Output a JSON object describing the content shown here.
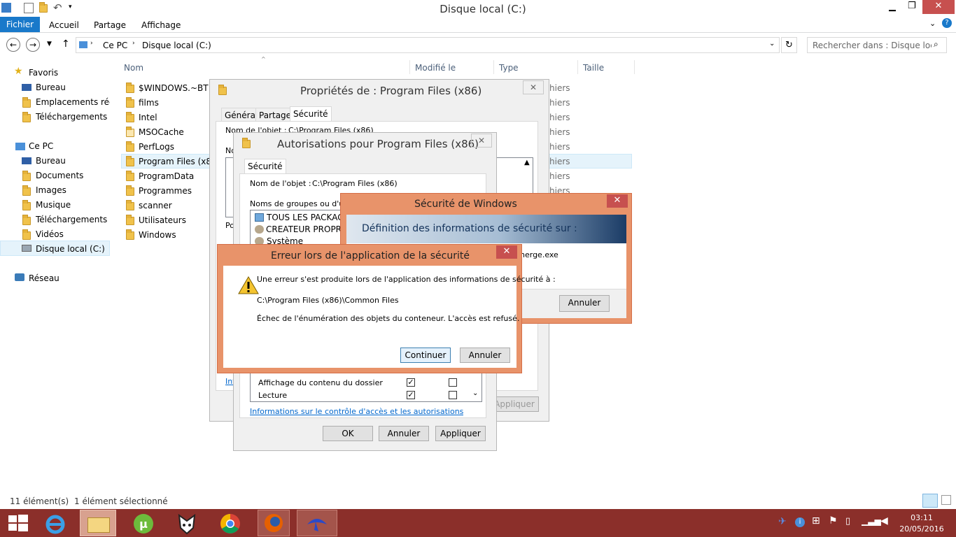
{
  "window": {
    "title": "Disque local (C:)"
  },
  "ribbon": {
    "tabs": [
      "Fichier",
      "Accueil",
      "Partage",
      "Affichage"
    ]
  },
  "address": {
    "segments": [
      "Ce PC",
      "Disque local (C:)"
    ],
    "search_placeholder": "Rechercher dans : Disque loca..."
  },
  "columns": {
    "name": "Nom",
    "modified": "Modifié le",
    "type": "Type",
    "size": "Taille"
  },
  "nav": {
    "favorites": "Favoris",
    "fav_items": [
      "Bureau",
      "Emplacements récen",
      "Téléchargements"
    ],
    "pc": "Ce PC",
    "pc_items": [
      "Bureau",
      "Documents",
      "Images",
      "Musique",
      "Téléchargements",
      "Vidéos",
      "Disque local (C:)"
    ],
    "network": "Réseau"
  },
  "files": [
    "$WINDOWS.~BT",
    "films",
    "Intel",
    "MSOCache",
    "PerfLogs",
    "Program Files (x86)",
    "ProgramData",
    "Programmes",
    "scanner",
    "Utilisateurs",
    "Windows"
  ],
  "type_fragments": [
    "hiers",
    "hiers",
    "hiers",
    "hiers",
    "hiers",
    "hiers",
    "hiers",
    "hiers"
  ],
  "status": {
    "count": "11 élément(s)",
    "selected": "1 élément sélectionné"
  },
  "props": {
    "title": "Propriétés de : Program Files (x86)",
    "tabs": [
      "Général",
      "Partage",
      "Sécurité"
    ],
    "object_label": "Nom de l'objet :",
    "object_value": "C:\\Program Files (x86)",
    "frag_no": "No",
    "frag_po": "Po",
    "frag_inf": "Inf",
    "apply": "Appliquer"
  },
  "perms": {
    "title": "Autorisations pour Program Files (x86)",
    "tab": "Sécurité",
    "object_label": "Nom de l'objet :",
    "object_value": "C:\\Program Files (x86)",
    "groups_label": "Noms de groupes ou d'utilisa",
    "groups": [
      "TOUS LES PACKAGE",
      "CREATEUR PROPRIE",
      "Système"
    ],
    "rows": [
      "Affichage du contenu du dossier",
      "Lecture"
    ],
    "link": "Informations sur le contrôle d'accès et les autorisations",
    "ok": "OK",
    "cancel": "Annuler",
    "apply": "Appliquer"
  },
  "winsec": {
    "title": "Sécurité de Windows",
    "header": "Définition des informations de sécurité sur :",
    "file_fragment": "nerge.exe",
    "cancel": "Annuler"
  },
  "error": {
    "title": "Erreur lors de l'application de la sécurité",
    "line1": "Une erreur s'est produite lors de l'application des informations de sécurité à :",
    "path": "C:\\Program Files (x86)\\Common Files",
    "line2": "Échec de l'énumération des objets du conteneur. L'accès est refusé.",
    "continue": "Continuer",
    "cancel": "Annuler"
  },
  "taskbar": {
    "time": "03:11",
    "date": "20/05/2016"
  },
  "colors": {
    "accent": "#1979ca",
    "dialog_border": "#e8936a",
    "close": "#c7504f"
  }
}
